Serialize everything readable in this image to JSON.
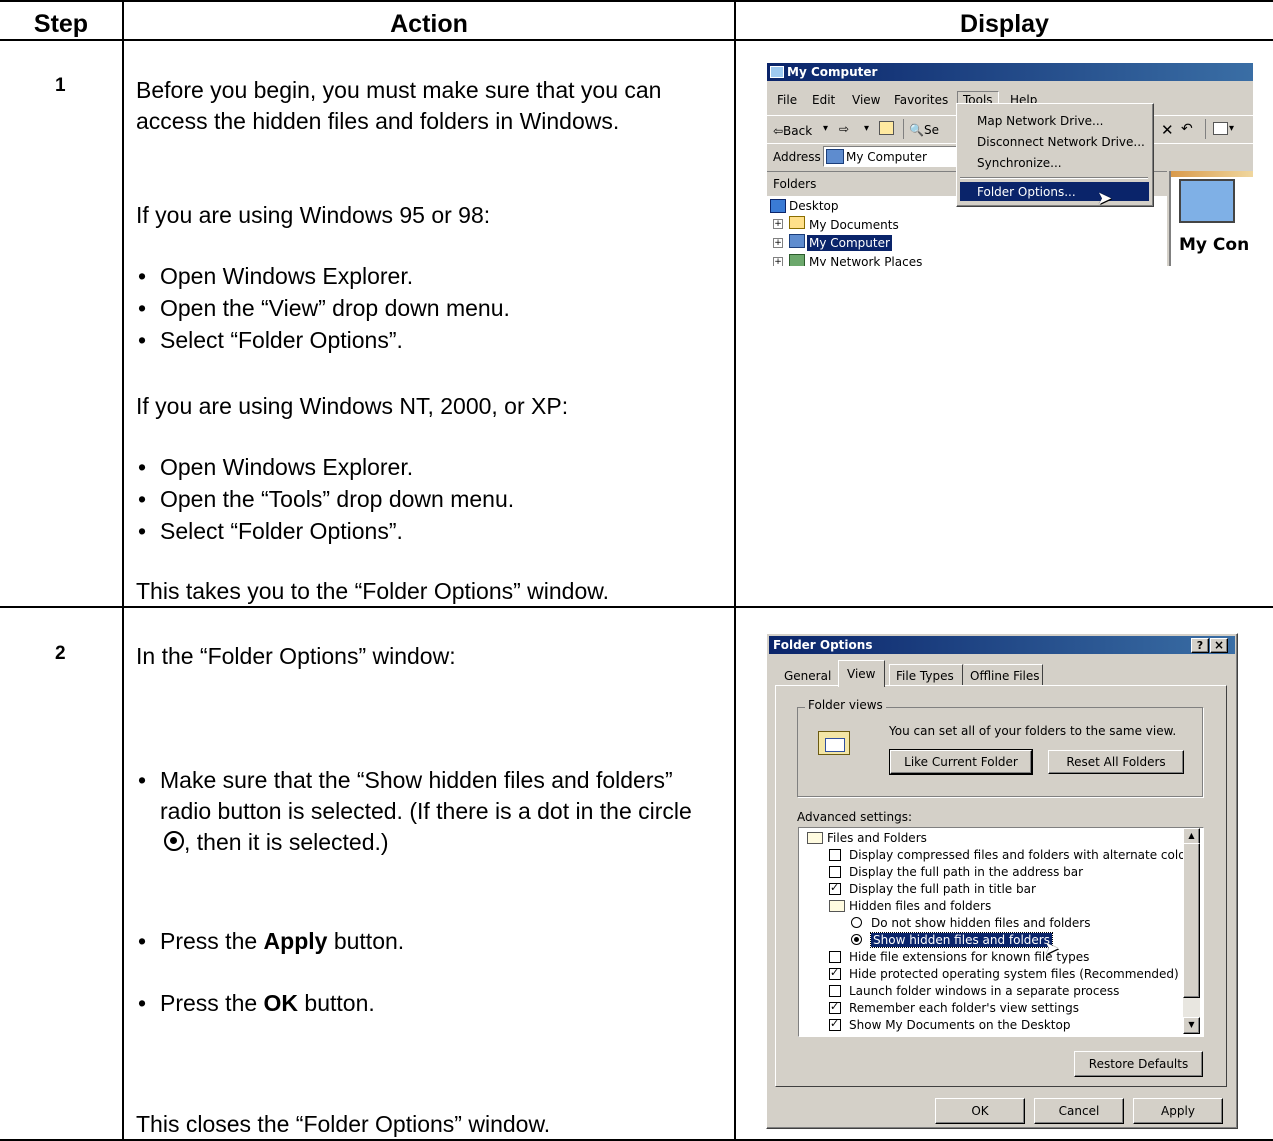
{
  "table": {
    "headers": {
      "step": "Step",
      "action": "Action",
      "display": "Display"
    },
    "rows": [
      {
        "step": "1",
        "intro": "Before you begin, you must make sure that you can access the hidden files and folders in Windows.",
        "w9x_heading": "If you are using Windows 95 or 98:",
        "w9x_bullets": [
          "Open Windows Explorer.",
          "Open the “View” drop down menu.",
          "Select “Folder Options”."
        ],
        "nt_heading": "If you are using Windows NT, 2000, or XP:",
        "nt_bullets": [
          "Open Windows Explorer.",
          "Open the “Tools” drop down menu.",
          "Select “Folder Options”."
        ],
        "outro": "This takes you to the “Folder Options” window."
      },
      {
        "step": "2",
        "intro": "In the “Folder Options” window:",
        "bullet_radio_a": "Make sure that the “Show hidden files and folders” radio button is selected.  (If there is a dot in the circle",
        "bullet_radio_b": ", then it is selected.)",
        "bullet_apply_pre": "Press the ",
        "bullet_apply_bold": "Apply",
        "bullet_apply_post": " button.",
        "bullet_ok_pre": "Press the ",
        "bullet_ok_bold": "OK",
        "bullet_ok_post": " button.",
        "outro": "This closes the “Folder Options” window."
      }
    ]
  },
  "explorer": {
    "title": "My Computer",
    "menu": [
      "File",
      "Edit",
      "View",
      "Favorites",
      "Tools",
      "Help"
    ],
    "toolbar": {
      "back": "⇦Back",
      "search": "Se"
    },
    "address_label": "Address",
    "address_value": "My Computer",
    "folders_label": "Folders",
    "tree": [
      "Desktop",
      "My Documents",
      "My Computer",
      "My Network Places"
    ],
    "tools_menu": [
      "Map Network Drive...",
      "Disconnect Network Drive...",
      "Synchronize...",
      "Folder Options..."
    ],
    "right_label": "My Con"
  },
  "folder_options": {
    "title": "Folder Options",
    "tabs": [
      "General",
      "View",
      "File Types",
      "Offline Files"
    ],
    "group_label": "Folder views",
    "group_text": "You can set all of your folders to the same view.",
    "like_current": "Like Current Folder",
    "reset_all": "Reset All Folders",
    "advanced_label": "Advanced settings:",
    "items": [
      {
        "kind": "folder",
        "label": "Files and Folders",
        "indent": 0
      },
      {
        "kind": "check",
        "checked": false,
        "label": "Display compressed files and folders with alternate color",
        "indent": 1
      },
      {
        "kind": "check",
        "checked": false,
        "label": "Display the full path in the address bar",
        "indent": 1
      },
      {
        "kind": "check",
        "checked": true,
        "label": "Display the full path in title bar",
        "indent": 1
      },
      {
        "kind": "folder",
        "label": "Hidden files and folders",
        "indent": 1
      },
      {
        "kind": "radio",
        "checked": false,
        "label": "Do not show hidden files and folders",
        "indent": 2
      },
      {
        "kind": "radio",
        "checked": true,
        "label": "Show hidden files and folders",
        "indent": 2,
        "selected": true
      },
      {
        "kind": "check",
        "checked": false,
        "label": "Hide file extensions for known file types",
        "indent": 1
      },
      {
        "kind": "check",
        "checked": true,
        "label": "Hide protected operating system files (Recommended)",
        "indent": 1
      },
      {
        "kind": "check",
        "checked": false,
        "label": "Launch folder windows in a separate process",
        "indent": 1
      },
      {
        "kind": "check",
        "checked": true,
        "label": "Remember each folder's view settings",
        "indent": 1
      },
      {
        "kind": "check",
        "checked": true,
        "label": "Show My Documents on the Desktop",
        "indent": 1
      }
    ],
    "restore_defaults": "Restore Defaults",
    "ok": "OK",
    "cancel": "Cancel",
    "apply": "Apply",
    "help_glyph": "?",
    "close_glyph": "×"
  }
}
